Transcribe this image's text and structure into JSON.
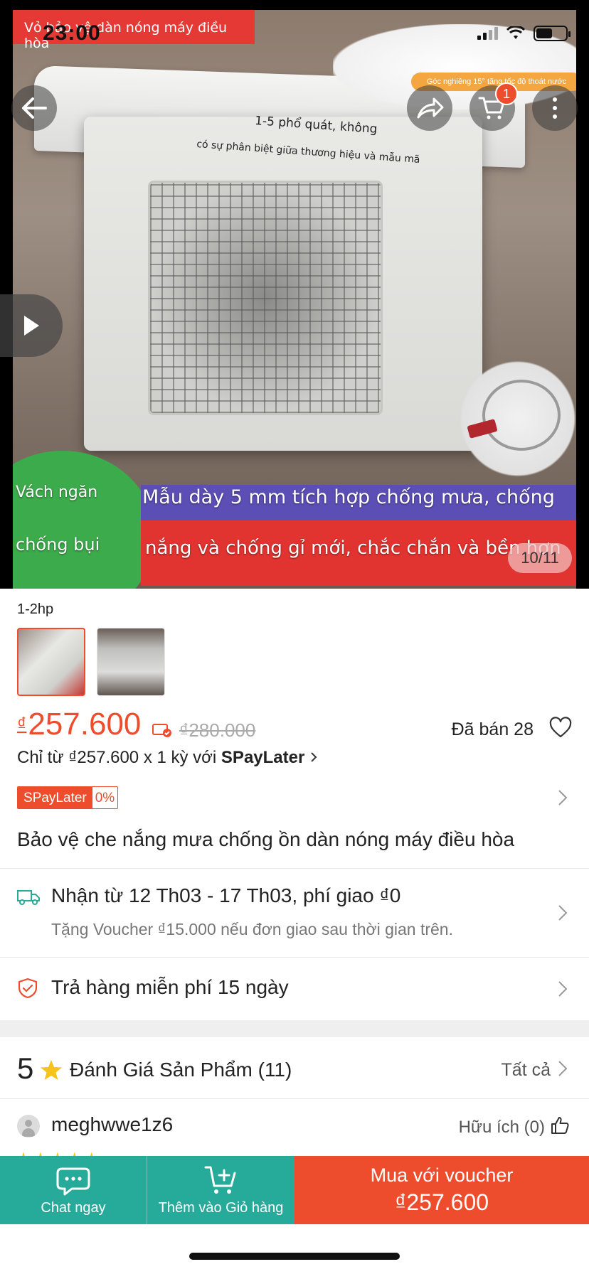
{
  "status_bar": {
    "time": "23:00"
  },
  "hero": {
    "top_banner": "Vỏ bảo vệ dàn nóng máy điều hòa",
    "inset_caption": "Góc nghiêng 15° tăng tốc độ thoát nước",
    "cover_line1": "1-5 phổ quát, không",
    "cover_line2": "có sự phân biệt giữa thương hiệu và mẫu mã",
    "left_caption_1": "Vách ngăn",
    "left_caption_2": "chống bụi",
    "banner_line1": "Mẫu dày 5 mm tích hợp chống mưa, chống",
    "banner_line2": "nắng và chống gỉ mới, chắc chắn và bền hơn",
    "counter": "10/11",
    "cart_count": "1"
  },
  "variation": {
    "label": "1-2hp"
  },
  "price": {
    "currency": "₫",
    "current": "257.600",
    "original": "₫280.000",
    "sold": "Đã bán 28",
    "installment_prefix": "Chỉ từ ₫257.600 x 1 kỳ với ",
    "installment_brand": "SPayLater",
    "spay_tag": "SPayLater",
    "spay_rate": "0%"
  },
  "product": {
    "title": "Bảo vệ che nắng mưa chống ồn dàn nóng máy điều hòa"
  },
  "shipping": {
    "main": "Nhận từ 12 Th03 - 17 Th03, phí giao ₫0",
    "sub": "Tặng Voucher ₫15.000 nếu đơn giao sau thời gian trên."
  },
  "returns": {
    "text": "Trả hàng miễn phí 15 ngày"
  },
  "rating": {
    "score": "5",
    "title": "Đánh Giá Sản Phẩm",
    "count": "(11)",
    "see_all": "Tất cả"
  },
  "review": {
    "username": "meghwwe1z6",
    "helpful": "Hữu ích (0)",
    "stars": "★★★★★"
  },
  "bottom_bar": {
    "chat": "Chat ngay",
    "add_to_cart": "Thêm vào Giỏ hàng",
    "buy_line1": "Mua với voucher",
    "buy_line2": "₫257.600"
  },
  "colors": {
    "accent": "#ee4d2d",
    "teal": "#26aa99",
    "star": "#f5c31a"
  }
}
